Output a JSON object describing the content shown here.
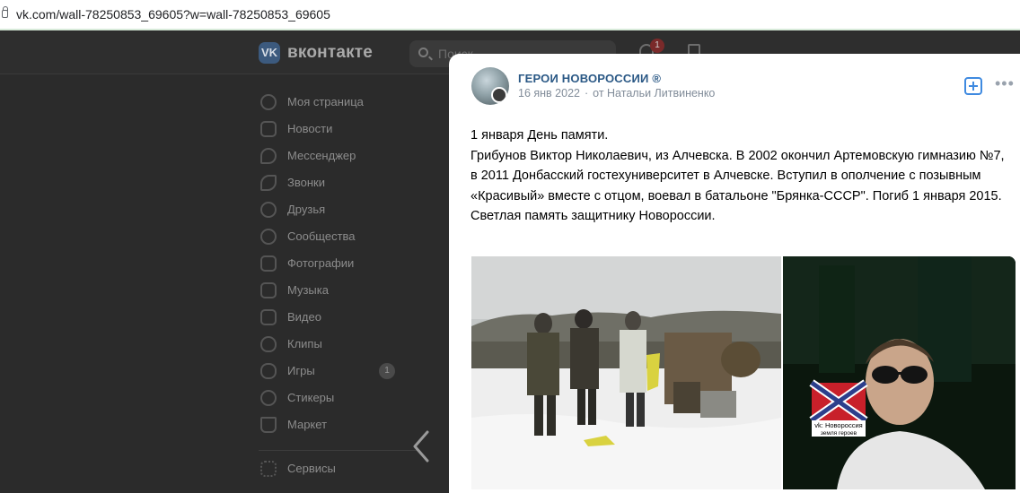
{
  "browser": {
    "url": "vk.com/wall-78250853_69605?w=wall-78250853_69605"
  },
  "header": {
    "logo_letter": "VK",
    "brand": "вконтакте",
    "search_placeholder": "Поиск",
    "notifications_count": "1"
  },
  "sidebar": {
    "items": [
      {
        "label": "Моя страница",
        "icon": "user-circle-icon"
      },
      {
        "label": "Новости",
        "icon": "news-icon"
      },
      {
        "label": "Мессенджер",
        "icon": "message-icon"
      },
      {
        "label": "Звонки",
        "icon": "phone-icon"
      },
      {
        "label": "Друзья",
        "icon": "friends-icon"
      },
      {
        "label": "Сообщества",
        "icon": "communities-icon"
      },
      {
        "label": "Фотографии",
        "icon": "photo-icon"
      },
      {
        "label": "Музыка",
        "icon": "music-icon"
      },
      {
        "label": "Видео",
        "icon": "video-icon"
      },
      {
        "label": "Клипы",
        "icon": "clips-icon"
      },
      {
        "label": "Игры",
        "icon": "games-icon",
        "badge": "1"
      },
      {
        "label": "Стикеры",
        "icon": "smile-icon"
      },
      {
        "label": "Маркет",
        "icon": "market-icon"
      },
      {
        "label": "Сервисы",
        "icon": "services-icon"
      }
    ]
  },
  "post": {
    "group_name": "ГЕРОИ НОВОРОССИИ ®",
    "date": "16 янв 2022",
    "author": "от Натальи Литвиненко",
    "text_lines": [
      "1 января День памяти.",
      "Грибунов Виктор Николаевич, из Алчевска. В 2002 окончил Артемовскую гимназию №7, в 2011 Донбасский гостехуниверситет в Алчевске. Вступил в ополчение с позывным «Красивый» вместе с отцом, воевал в батальоне \"Брянка-СССР\". Погиб 1 января 2015.",
      "Светлая память защитнику Новороссии."
    ],
    "photo2_caption_line1": "vk: Новороссия",
    "photo2_caption_line2": "земля героев"
  },
  "colors": {
    "link": "#2a5885",
    "accent": "#3f8ae0",
    "meta": "#818c99",
    "overlay": "#2b2b2b"
  }
}
